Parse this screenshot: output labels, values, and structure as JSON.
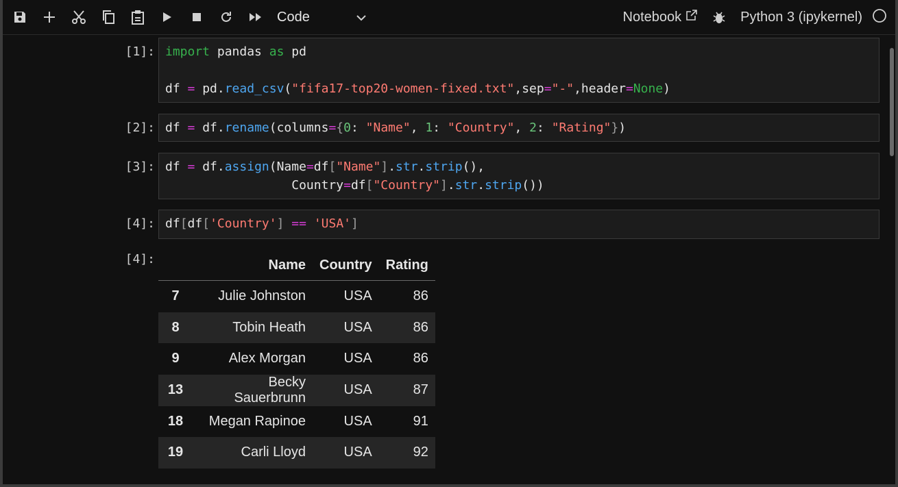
{
  "toolbar": {
    "buttons": [
      "save-icon",
      "add-icon",
      "cut-icon",
      "copy-icon",
      "paste-icon",
      "run-icon",
      "stop-icon",
      "restart-icon",
      "fast-forward-icon"
    ],
    "cell_type": "Code",
    "notebook_label": "Notebook",
    "kernel_label": "Python 3 (ipykernel)"
  },
  "cells": [
    {
      "prompt": "[1]:"
    },
    {
      "prompt": "[2]:"
    },
    {
      "prompt": "[3]:"
    },
    {
      "prompt": "[4]:"
    }
  ],
  "output": {
    "prompt": "[4]:",
    "columns": [
      "Name",
      "Country",
      "Rating"
    ],
    "rows": [
      {
        "index": "7",
        "name": "Julie Johnston",
        "country": "USA",
        "rating": "86"
      },
      {
        "index": "8",
        "name": "Tobin Heath",
        "country": "USA",
        "rating": "86"
      },
      {
        "index": "9",
        "name": "Alex Morgan",
        "country": "USA",
        "rating": "86"
      },
      {
        "index": "13",
        "name": "Becky Sauerbrunn",
        "country": "USA",
        "rating": "87"
      },
      {
        "index": "18",
        "name": "Megan Rapinoe",
        "country": "USA",
        "rating": "91"
      },
      {
        "index": "19",
        "name": "Carli Lloyd",
        "country": "USA",
        "rating": "92"
      }
    ]
  },
  "code": {
    "c1": {
      "t1": "import",
      "t2": " pandas ",
      "t3": "as",
      "t4": " pd",
      "t5": "df ",
      "t6": "=",
      "t7": " pd.",
      "t8": "read_csv",
      "t9": "(",
      "t10": "\"fifa17-top20-women-fixed.txt\"",
      "t11": ",sep",
      "t12": "=",
      "t13": "\"-\"",
      "t14": ",header",
      "t15": "=",
      "t16": "None",
      "t17": ")"
    },
    "c2": {
      "t1": "df ",
      "t2": "=",
      "t3": " df.",
      "t4": "rename",
      "t5": "(columns",
      "t6": "=",
      "t7": "{",
      "t8": "0",
      "t9": ": ",
      "t10": "\"Name\"",
      "t11": ", ",
      "t12": "1",
      "t13": ": ",
      "t14": "\"Country\"",
      "t15": ", ",
      "t16": "2",
      "t17": ": ",
      "t18": "\"Rating\"",
      "t19": "}",
      "t20": ")"
    },
    "c3": {
      "t1": "df ",
      "t2": "=",
      "t3": " df.",
      "t4": "assign",
      "t5": "(Name",
      "t6": "=",
      "t7": "df",
      "t8": "[",
      "t9": "\"Name\"",
      "t10": "]",
      "t11": ".",
      "t12": "str",
      "t13": ".",
      "t14": "strip",
      "t15": "(),",
      "t16": "                 Country",
      "t17": "=",
      "t18": "df",
      "t19": "[",
      "t20": "\"Country\"",
      "t21": "]",
      "t22": ".",
      "t23": "str",
      "t24": ".",
      "t25": "strip",
      "t26": "())"
    },
    "c4": {
      "t1": "df",
      "t2": "[",
      "t3": "df",
      "t4": "[",
      "t5": "'Country'",
      "t6": "] ",
      "t7": "==",
      "t8": " ",
      "t9": "'USA'",
      "t10": "]"
    }
  }
}
